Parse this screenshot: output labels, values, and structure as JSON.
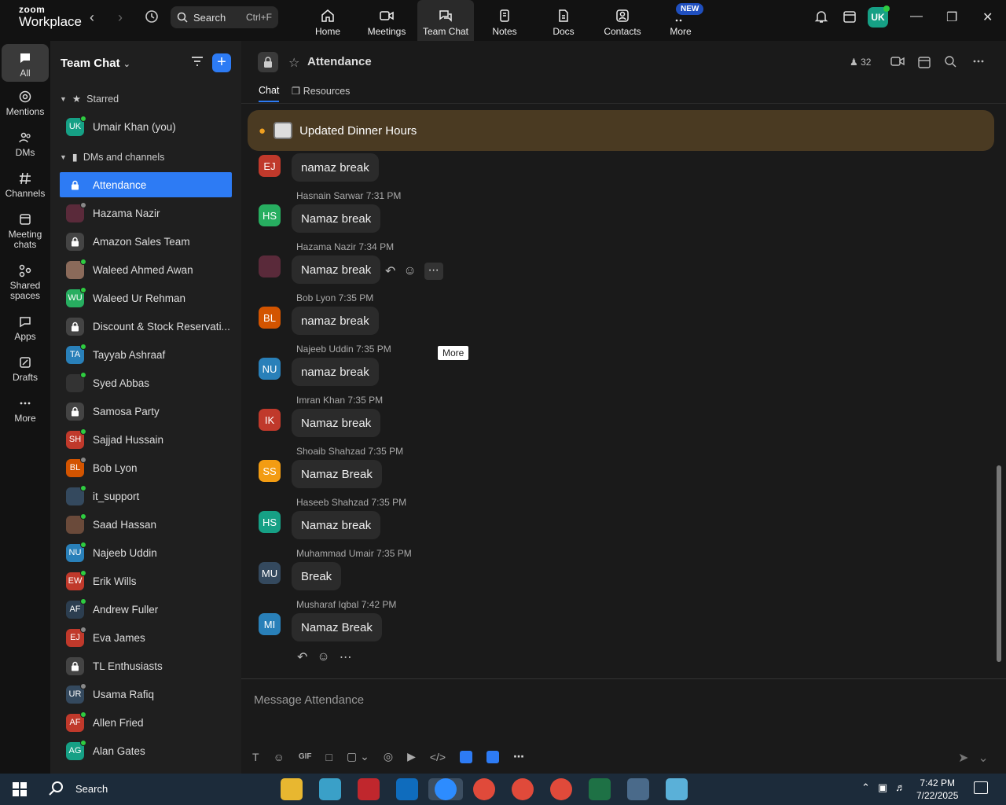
{
  "app": {
    "logo_line1": "zoom",
    "logo_line2": "Workplace",
    "search_label": "Search",
    "search_shortcut": "Ctrl+F",
    "new_badge": "NEW",
    "user_initials": "UK"
  },
  "top_tabs": [
    {
      "label": "Home",
      "icon": "home-icon"
    },
    {
      "label": "Meetings",
      "icon": "video-icon"
    },
    {
      "label": "Team Chat",
      "icon": "chat-icon",
      "active": true
    },
    {
      "label": "Notes",
      "icon": "notes-icon"
    },
    {
      "label": "Docs",
      "icon": "docs-icon"
    },
    {
      "label": "Contacts",
      "icon": "contacts-icon"
    },
    {
      "label": "More",
      "icon": "more-icon"
    }
  ],
  "rail": [
    {
      "label": "All",
      "icon": "chat-bubble-icon",
      "active": true
    },
    {
      "label": "Mentions",
      "icon": "at-icon"
    },
    {
      "label": "DMs",
      "icon": "people-icon"
    },
    {
      "label": "Channels",
      "icon": "hash-icon"
    },
    {
      "label": "Meeting chats",
      "icon": "calendar-icon"
    },
    {
      "label": "Shared spaces",
      "icon": "share-icon"
    },
    {
      "label": "Apps",
      "icon": "apps-icon"
    },
    {
      "label": "Drafts",
      "icon": "drafts-icon"
    },
    {
      "label": "More",
      "icon": "ellipsis-icon"
    }
  ],
  "sidebar": {
    "title": "Team Chat",
    "starred_label": "Starred",
    "starred": [
      {
        "name": "Umair Khan (you)",
        "initials": "UK",
        "color": "#16a085",
        "status": "on"
      }
    ],
    "dms_label": "DMs and channels",
    "items": [
      {
        "name": "Attendance",
        "type": "lock",
        "selected": true
      },
      {
        "name": "Hazama Nazir",
        "initials": "",
        "color": "#5a2a3a",
        "status": "off"
      },
      {
        "name": "Amazon Sales Team",
        "type": "lock"
      },
      {
        "name": "Waleed Ahmed Awan",
        "initials": "",
        "color": "#8a6a5a",
        "status": "on"
      },
      {
        "name": "Waleed Ur Rehman",
        "initials": "WU",
        "color": "#27ae60",
        "status": "on"
      },
      {
        "name": "Discount & Stock Reservati...",
        "type": "lock"
      },
      {
        "name": "Tayyab Ashraaf",
        "initials": "TA",
        "color": "#2980b9",
        "status": "on"
      },
      {
        "name": "Syed Abbas",
        "initials": "",
        "color": "#333333",
        "status": "on"
      },
      {
        "name": "Samosa Party",
        "type": "lock"
      },
      {
        "name": "Sajjad Hussain",
        "initials": "SH",
        "color": "#c0392b",
        "status": "on"
      },
      {
        "name": "Bob Lyon",
        "initials": "BL",
        "color": "#d35400",
        "status": "off"
      },
      {
        "name": "it_support",
        "initials": "",
        "color": "#34495e",
        "status": "on"
      },
      {
        "name": "Saad Hassan",
        "initials": "",
        "color": "#6a4a3a",
        "status": "on"
      },
      {
        "name": "Najeeb Uddin",
        "initials": "NU",
        "color": "#2980b9",
        "status": "on"
      },
      {
        "name": "Erik Wills",
        "initials": "EW",
        "color": "#c0392b",
        "status": "on"
      },
      {
        "name": "Andrew Fuller",
        "initials": "AF",
        "color": "#2c3e50",
        "status": "on"
      },
      {
        "name": "Eva James",
        "initials": "EJ",
        "color": "#c0392b",
        "status": "off"
      },
      {
        "name": "TL Enthusiasts",
        "type": "lock"
      },
      {
        "name": "Usama Rafiq",
        "initials": "UR",
        "color": "#34495e",
        "status": "off"
      },
      {
        "name": "Allen Fried",
        "initials": "AF",
        "color": "#c0392b",
        "status": "on"
      },
      {
        "name": "Alan Gates",
        "initials": "AG",
        "color": "#16a085",
        "status": "on"
      }
    ]
  },
  "channel": {
    "title": "Attendance",
    "members": "32",
    "tabs": [
      "Chat",
      "Resources"
    ],
    "pinned": "Updated Dinner Hours",
    "composer_placeholder": "Message Attendance",
    "tooltip": "More",
    "first_message": {
      "initials": "EJ",
      "color": "#c0392b",
      "text": "namaz break"
    },
    "messages": [
      {
        "sender": "Hasnain Sarwar",
        "time": "7:31 PM",
        "initials": "HS",
        "color": "#27ae60",
        "text": "Namaz break"
      },
      {
        "sender": "Hazama Nazir",
        "time": "7:34 PM",
        "initials": "",
        "color": "#5a2a3a",
        "text": "Namaz break"
      },
      {
        "sender": "Bob Lyon",
        "time": "7:35 PM",
        "initials": "BL",
        "color": "#d35400",
        "text": "namaz break"
      },
      {
        "sender": "Najeeb Uddin",
        "time": "7:35 PM",
        "initials": "NU",
        "color": "#2980b9",
        "text": "namaz break"
      },
      {
        "sender": "Imran Khan",
        "time": "7:35 PM",
        "initials": "IK",
        "color": "#c0392b",
        "text": "Namaz break"
      },
      {
        "sender": "Shoaib Shahzad",
        "time": "7:35 PM",
        "initials": "SS",
        "color": "#f39c12",
        "text": "Namaz Break"
      },
      {
        "sender": "Haseeb Shahzad",
        "time": "7:35 PM",
        "initials": "HS",
        "color": "#16a085",
        "text": "Namaz break"
      },
      {
        "sender": "Muhammad Umair",
        "time": "7:35 PM",
        "initials": "MU",
        "color": "#34495e",
        "text": "Break"
      },
      {
        "sender": "Musharaf Iqbal",
        "time": "7:42 PM",
        "initials": "MI",
        "color": "#2980b9",
        "text": "Namaz Break"
      }
    ]
  },
  "taskbar": {
    "search_label": "Search",
    "time": "7:42 PM",
    "date": "7/22/2025"
  }
}
